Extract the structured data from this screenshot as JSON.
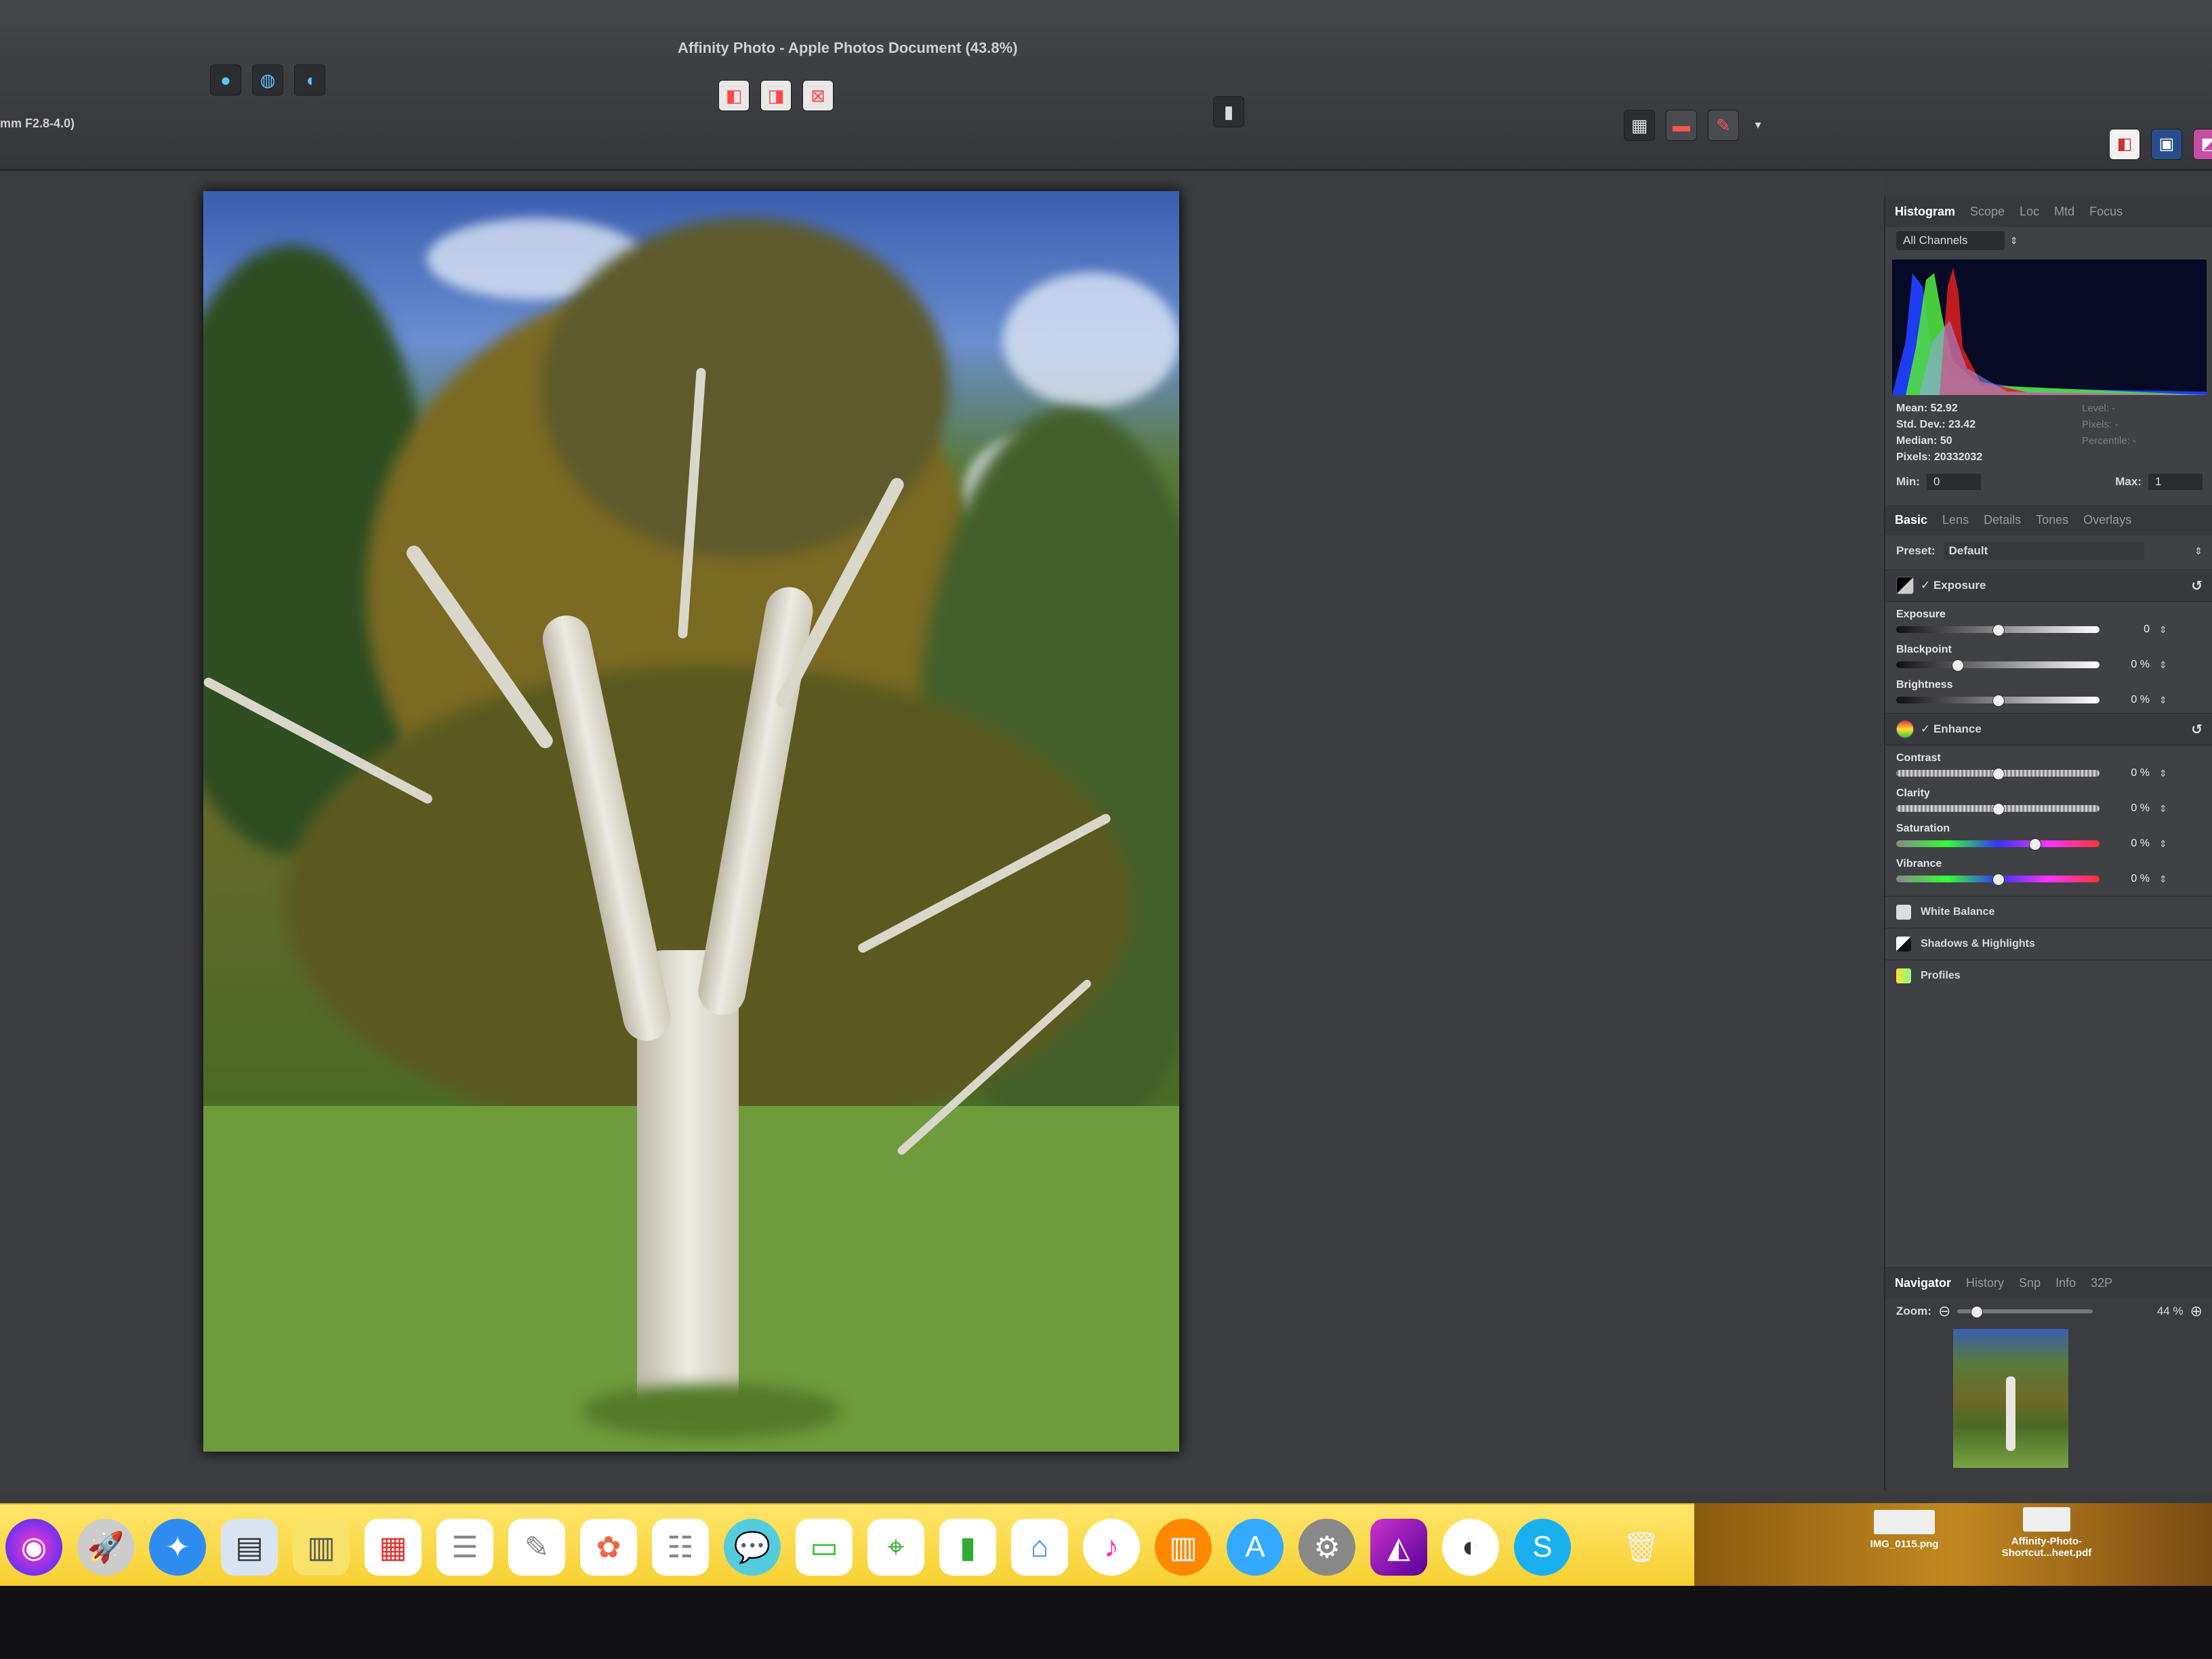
{
  "window": {
    "title": "Affinity Photo - Apple Photos Document (43.8%)",
    "lens_info": "mm F2.8-4.0)"
  },
  "histogram": {
    "tabs": [
      "Histogram",
      "Scope",
      "Loc",
      "Mtd",
      "Focus"
    ],
    "channel_select": "All Channels",
    "stats": {
      "mean": "Mean: 52.92",
      "std_dev": "Std. Dev.: 23.42",
      "median": "Median: 50",
      "pixels": "Pixels: 20332032"
    },
    "right_stats": {
      "level": "Level: -",
      "pixels": "Pixels: -",
      "percentile": "Percentile: -"
    },
    "min_label": "Min:",
    "min_value": "0",
    "max_label": "Max:",
    "max_value": "1"
  },
  "develop": {
    "tabs": [
      "Basic",
      "Lens",
      "Details",
      "Tones",
      "Overlays"
    ],
    "preset_label": "Preset:",
    "preset_value": "Default",
    "exposure_section": {
      "title": "✓ Exposure",
      "sliders": [
        {
          "label": "Exposure",
          "value": "0",
          "position": 0.5
        },
        {
          "label": "Blackpoint",
          "value": "0 %",
          "position": 0.3
        },
        {
          "label": "Brightness",
          "value": "0 %",
          "position": 0.5
        }
      ]
    },
    "enhance_section": {
      "title": "✓ Enhance",
      "sliders": [
        {
          "label": "Contrast",
          "value": "0 %",
          "position": 0.5
        },
        {
          "label": "Clarity",
          "value": "0 %",
          "position": 0.5
        },
        {
          "label": "Saturation",
          "value": "0 %",
          "position": 0.68
        },
        {
          "label": "Vibrance",
          "value": "0 %",
          "position": 0.5
        }
      ]
    },
    "collapsed_sections": [
      "White Balance",
      "Shadows & Highlights",
      "Profiles"
    ]
  },
  "navigator": {
    "tabs": [
      "Navigator",
      "History",
      "Snp",
      "Info",
      "32P"
    ],
    "zoom_label": "Zoom:",
    "zoom_value": "44 %"
  },
  "desktop": {
    "files": [
      {
        "name": "IMG_0115.png"
      },
      {
        "name": "Affinity-Photo-Shortcut...heet.pdf"
      }
    ]
  },
  "colors": {
    "accent": "#5cc3ff",
    "panel_bg": "#404144",
    "dock_bg": "#f6cf2f"
  }
}
